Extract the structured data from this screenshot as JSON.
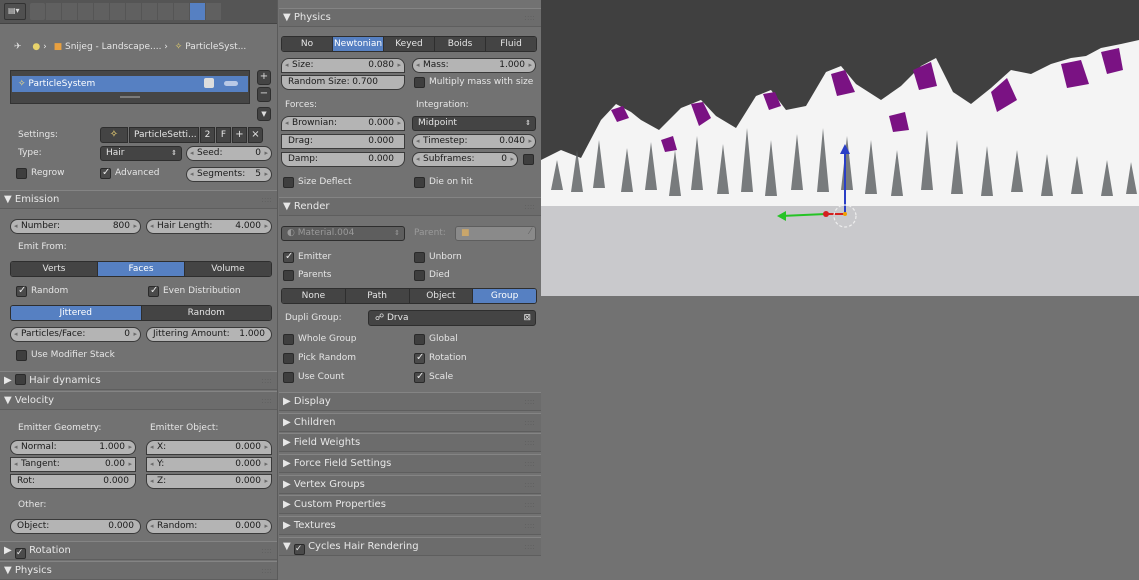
{
  "left": {
    "breadcrumb": {
      "object": "Snijeg - Landscape....",
      "particle": "ParticleSyst..."
    },
    "list": {
      "item": "ParticleSystem"
    },
    "settings_label": "Settings:",
    "settings_value": "ParticleSetti...",
    "settings_users": "2",
    "settings_fake": "F",
    "type_label": "Type:",
    "type_value": "Hair",
    "seed": {
      "label": "Seed:",
      "value": "0"
    },
    "regrow": "Regrow",
    "advanced": "Advanced",
    "segments": {
      "label": "Segments:",
      "value": "5"
    },
    "emission": {
      "title": "Emission",
      "number": {
        "label": "Number:",
        "value": "800"
      },
      "hair_length": {
        "label": "Hair Length:",
        "value": "4.000"
      },
      "emit_from": "Emit From:",
      "source_tabs": [
        "Verts",
        "Faces",
        "Volume"
      ],
      "random": "Random",
      "even_distribution": "Even Distribution",
      "dist_tabs": [
        "Jittered",
        "Random"
      ],
      "particles_face": {
        "label": "Particles/Face:",
        "value": "0"
      },
      "jittering": {
        "label": "Jittering Amount:",
        "value": "1.000"
      },
      "use_modifier_stack": "Use Modifier Stack"
    },
    "hair_dynamics": "Hair dynamics",
    "velocity": {
      "title": "Velocity",
      "emitter_geometry": "Emitter Geometry:",
      "emitter_object": "Emitter Object:",
      "normal": {
        "label": "Normal:",
        "value": "1.000"
      },
      "tangent": {
        "label": "Tangent:",
        "value": "0.00"
      },
      "rot": {
        "label": "Rot:",
        "value": "0.000"
      },
      "x": {
        "label": "X:",
        "value": "0.000"
      },
      "y": {
        "label": "Y:",
        "value": "0.000"
      },
      "z": {
        "label": "Z:",
        "value": "0.000"
      },
      "other": "Other:",
      "object": {
        "label": "Object:",
        "value": "0.000"
      },
      "random": {
        "label": "Random:",
        "value": "0.000"
      }
    },
    "rotation": "Rotation",
    "physics": "Physics"
  },
  "mid": {
    "physics": {
      "title": "Physics",
      "tabs": [
        "No",
        "Newtonian",
        "Keyed",
        "Boids",
        "Fluid"
      ],
      "size": {
        "label": "Size:",
        "value": "0.080"
      },
      "mass": {
        "label": "Mass:",
        "value": "1.000"
      },
      "random_size": {
        "label": "Random Size:",
        "value": "0.700"
      },
      "multiply_mass": "Multiply mass with size",
      "forces": "Forces:",
      "integration": "Integration:",
      "brownian": {
        "label": "Brownian:",
        "value": "0.000"
      },
      "integration_value": "Midpoint",
      "drag": {
        "label": "Drag:",
        "value": "0.000"
      },
      "timestep": {
        "label": "Timestep:",
        "value": "0.040"
      },
      "damp": {
        "label": "Damp:",
        "value": "0.000"
      },
      "subframes": {
        "label": "Subframes:",
        "value": "0"
      },
      "size_deflect": "Size Deflect",
      "die_on_hit": "Die on hit"
    },
    "render": {
      "title": "Render",
      "material": "Material.004",
      "parent": "Parent:",
      "emitter": "Emitter",
      "unborn": "Unborn",
      "parents": "Parents",
      "died": "Died",
      "tabs": [
        "None",
        "Path",
        "Object",
        "Group"
      ],
      "dupli_group_label": "Dupli Group:",
      "dupli_group_value": "Drva",
      "whole_group": "Whole Group",
      "global": "Global",
      "pick_random": "Pick Random",
      "rotation": "Rotation",
      "use_count": "Use Count",
      "scale": "Scale"
    },
    "collapsed": [
      "Display",
      "Children",
      "Field Weights",
      "Force Field Settings",
      "Vertex Groups",
      "Custom Properties",
      "Textures"
    ],
    "cycles_hair": "Cycles Hair Rendering"
  },
  "colors": {
    "panel": "#727272",
    "active_tab": "#5680c2",
    "sky": "#404040",
    "ground": "#c9c9cc",
    "snow": "#f4f4f4",
    "magenta": "#7a1283"
  }
}
